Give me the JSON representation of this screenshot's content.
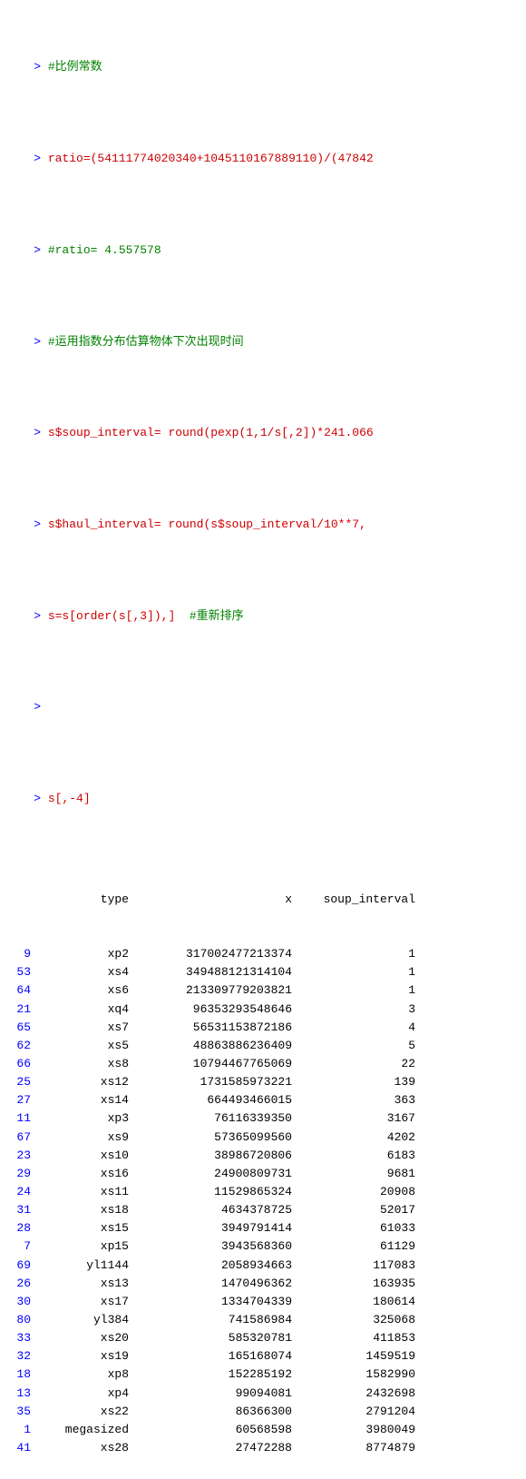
{
  "console": {
    "lines": [
      {
        "type": "comment",
        "prompt": "> ",
        "text": "#比例常数"
      },
      {
        "type": "code",
        "prompt": "> ",
        "text": "ratio=(54111774020340+1045110167889110)/(47842"
      },
      {
        "type": "output",
        "prompt": "> ",
        "text": "#ratio= 4.557578"
      },
      {
        "type": "comment",
        "prompt": "> ",
        "text": "#运用指数分布估算物体下次出现时间"
      },
      {
        "type": "code",
        "prompt": "> ",
        "text": "s$soup_interval= round(pexp(1,1/s[,2])*241.066"
      },
      {
        "type": "code",
        "prompt": "> ",
        "text": "s$haul_interval= round(s$soup_interval/10**7,"
      },
      {
        "type": "code",
        "prompt": "> ",
        "text": "s=s[order(s[,3]),]  #重新排序"
      },
      {
        "type": "empty",
        "prompt": ">",
        "text": ""
      },
      {
        "type": "code",
        "prompt": "> ",
        "text": "s[,-4]"
      }
    ],
    "table": {
      "headers": [
        "type",
        "x",
        "soup_interval"
      ],
      "rows": [
        {
          "rownum": "9",
          "type": "xp2",
          "x": "317002477213374",
          "soup": "1"
        },
        {
          "rownum": "53",
          "type": "xs4",
          "x": "349488121314104",
          "soup": "1"
        },
        {
          "rownum": "64",
          "type": "xs6",
          "x": "213309779203821",
          "soup": "1"
        },
        {
          "rownum": "21",
          "type": "xq4",
          "x": "96353293548646",
          "soup": "3"
        },
        {
          "rownum": "65",
          "type": "xs7",
          "x": "56531153872186",
          "soup": "4"
        },
        {
          "rownum": "62",
          "type": "xs5",
          "x": "48863886236409",
          "soup": "5"
        },
        {
          "rownum": "66",
          "type": "xs8",
          "x": "10794467765069",
          "soup": "22"
        },
        {
          "rownum": "25",
          "type": "xs12",
          "x": "1731585973221",
          "soup": "139"
        },
        {
          "rownum": "27",
          "type": "xs14",
          "x": "664493466015",
          "soup": "363"
        },
        {
          "rownum": "11",
          "type": "xp3",
          "x": "76116339350",
          "soup": "3167"
        },
        {
          "rownum": "67",
          "type": "xs9",
          "x": "57365099560",
          "soup": "4202"
        },
        {
          "rownum": "23",
          "type": "xs10",
          "x": "38986720806",
          "soup": "6183"
        },
        {
          "rownum": "29",
          "type": "xs16",
          "x": "24900809731",
          "soup": "9681"
        },
        {
          "rownum": "24",
          "type": "xs11",
          "x": "11529865324",
          "soup": "20908"
        },
        {
          "rownum": "31",
          "type": "xs18",
          "x": "4634378725",
          "soup": "52017"
        },
        {
          "rownum": "28",
          "type": "xs15",
          "x": "3949791414",
          "soup": "61033"
        },
        {
          "rownum": "7",
          "type": "xp15",
          "x": "3943568360",
          "soup": "61129"
        },
        {
          "rownum": "69",
          "type": "yl1144",
          "x": "2058934663",
          "soup": "117083"
        },
        {
          "rownum": "26",
          "type": "xs13",
          "x": "1470496362",
          "soup": "163935"
        },
        {
          "rownum": "30",
          "type": "xs17",
          "x": "1334704339",
          "soup": "180614"
        },
        {
          "rownum": "80",
          "type": "yl384",
          "x": "741586984",
          "soup": "325068"
        },
        {
          "rownum": "33",
          "type": "xs20",
          "x": "585320781",
          "soup": "411853"
        },
        {
          "rownum": "32",
          "type": "xs19",
          "x": "165168074",
          "soup": "1459519"
        },
        {
          "rownum": "18",
          "type": "xp8",
          "x": "152285192",
          "soup": "1582990"
        },
        {
          "rownum": "13",
          "type": "xp4",
          "x": "99094081",
          "soup": "2432698"
        },
        {
          "rownum": "35",
          "type": "xs22",
          "x": "86366300",
          "soup": "2791204"
        },
        {
          "rownum": "1",
          "type": "megasized",
          "x": "60568598",
          "soup": "3980049"
        },
        {
          "rownum": "41",
          "type": "xs28",
          "x": "27472288",
          "soup": "8774879"
        }
      ]
    }
  }
}
